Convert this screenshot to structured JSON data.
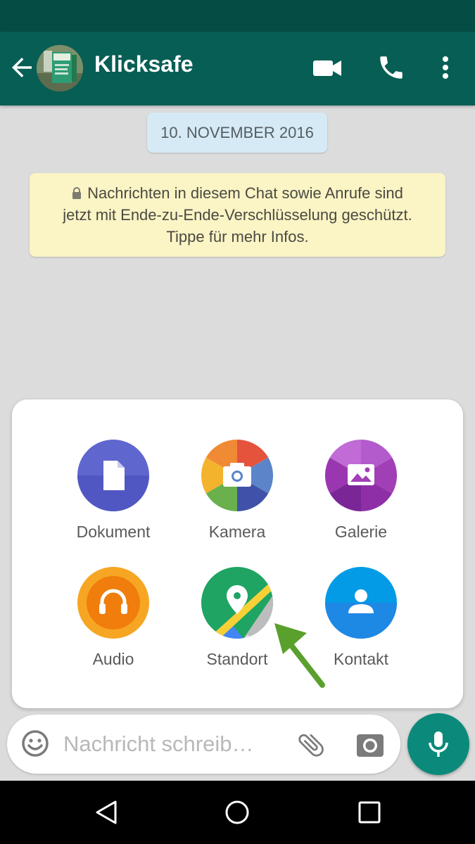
{
  "header": {
    "title": "Klicksafe",
    "avatar_icon": "contact-photo-icon",
    "back_icon": "arrow-left-icon",
    "video_icon": "videocam-icon",
    "call_icon": "phone-icon",
    "menu_icon": "more-vert-icon"
  },
  "chat": {
    "date": "10. NOVEMBER 2016",
    "encryption_notice_lines": [
      "Nachrichten in diesem Chat sowie Anrufe sind",
      "jetzt mit Ende-zu-Ende-Verschlüsselung geschützt.",
      "Tippe für mehr Infos."
    ]
  },
  "attachments": {
    "items": [
      {
        "label": "Dokument",
        "icon": "document-icon",
        "color": "#5f66cd"
      },
      {
        "label": "Kamera",
        "icon": "camera-icon",
        "color": "multicolor"
      },
      {
        "label": "Galerie",
        "icon": "gallery-icon",
        "color": "#ab47bc"
      },
      {
        "label": "Audio",
        "icon": "headphones-icon",
        "color": "#f57c00"
      },
      {
        "label": "Standort",
        "icon": "location-pin-icon",
        "color": "#1fa463"
      },
      {
        "label": "Kontakt",
        "icon": "contact-person-icon",
        "color": "#039be5"
      }
    ],
    "highlight": "Standort"
  },
  "composer": {
    "placeholder": "Nachricht schreib…",
    "value": "",
    "emoji_icon": "emoji-icon",
    "attach_icon": "paperclip-icon",
    "camera_icon": "camera-icon",
    "mic_icon": "microphone-icon"
  },
  "colors": {
    "appbar": "#075e54",
    "statusbar": "#054d44",
    "accent": "#0b8a7b",
    "annotation_arrow": "#5aa02c"
  }
}
